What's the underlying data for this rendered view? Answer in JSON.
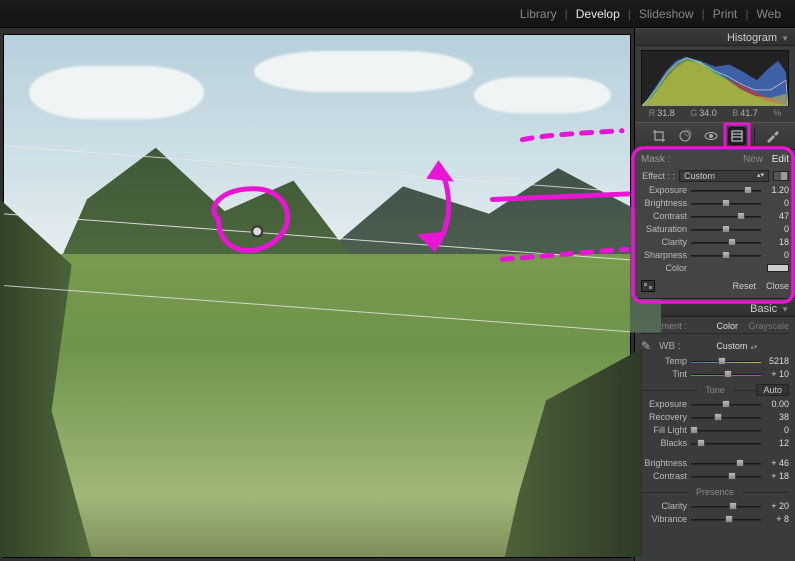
{
  "topnav": {
    "items": [
      "Library",
      "Develop",
      "Slideshow",
      "Print",
      "Web"
    ],
    "active": "Develop"
  },
  "histogram": {
    "title": "Histogram",
    "r_label": "R",
    "r_val": "31.8",
    "g_label": "G",
    "g_val": "34.0",
    "b_label": "B",
    "b_val": "41.7",
    "pct": "%"
  },
  "mask_panel": {
    "mask_label": "Mask :",
    "new_label": "New",
    "edit_label": "Edit",
    "effect_label": "Effect :",
    "effect_value": "Custom",
    "sliders": [
      {
        "label": "Exposure",
        "value": "1.20",
        "pos": 82
      },
      {
        "label": "Brightness",
        "value": "0",
        "pos": 50
      },
      {
        "label": "Contrast",
        "value": "47",
        "pos": 72
      },
      {
        "label": "Saturation",
        "value": "0",
        "pos": 50
      },
      {
        "label": "Clarity",
        "value": "18",
        "pos": 58
      },
      {
        "label": "Sharpness",
        "value": "0",
        "pos": 50
      }
    ],
    "color_label": "Color",
    "reset_label": "Reset",
    "close_label": "Close"
  },
  "basic_panel": {
    "title": "Basic",
    "treat_label": "Treatment :",
    "color_label": "Color",
    "gray_label": "Grayscale",
    "wb_label": "WB :",
    "wb_value": "Custom",
    "temp": {
      "label": "Temp",
      "value": "5218",
      "pos": 44
    },
    "tint": {
      "label": "Tint",
      "value": "+ 10",
      "pos": 53
    },
    "tone_head": "Tone",
    "auto_label": "Auto",
    "tone": [
      {
        "label": "Exposure",
        "value": "0.00",
        "pos": 50
      },
      {
        "label": "Recovery",
        "value": "38",
        "pos": 38
      },
      {
        "label": "Fill Light",
        "value": "0",
        "pos": 4
      },
      {
        "label": "Blacks",
        "value": "12",
        "pos": 14
      }
    ],
    "tone2": [
      {
        "label": "Brightness",
        "value": "+ 46",
        "pos": 70
      },
      {
        "label": "Contrast",
        "value": "+ 18",
        "pos": 58
      }
    ],
    "presence_head": "Presence",
    "presence": [
      {
        "label": "Clarity",
        "value": "+ 20",
        "pos": 60
      },
      {
        "label": "Vibrance",
        "value": "+ 8",
        "pos": 54
      }
    ]
  }
}
